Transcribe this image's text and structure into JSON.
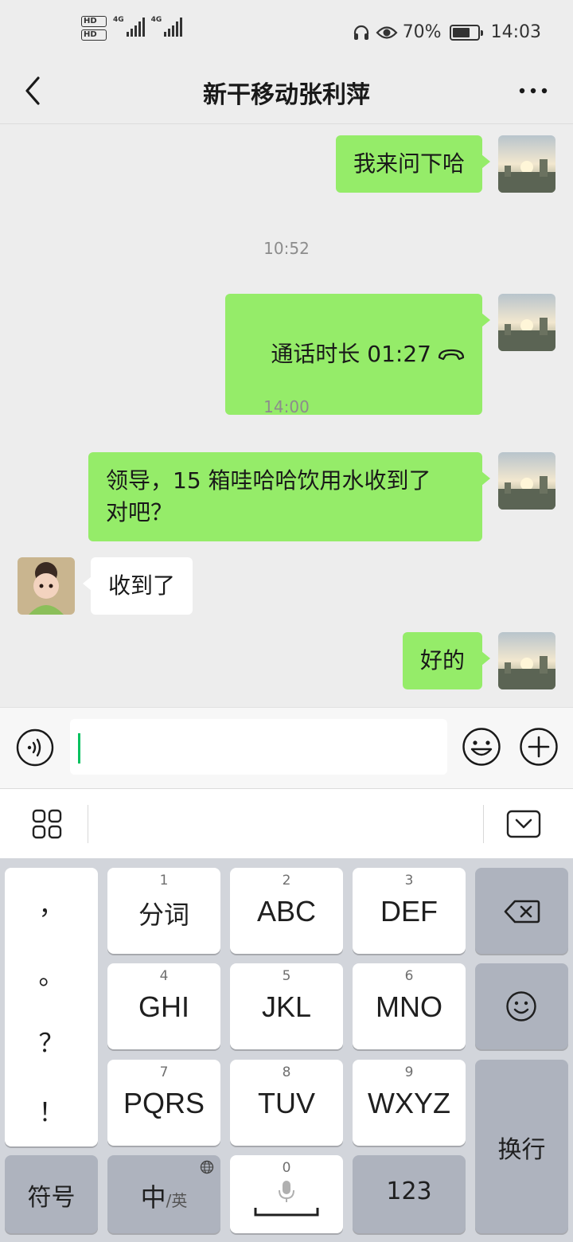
{
  "status_bar": {
    "hd1": "HD",
    "hd2": "HD",
    "sim1_net": "4G",
    "sim2_net": "4G",
    "battery_percent_text": "70%",
    "battery_level": 0.7,
    "time": "14:03",
    "icons": [
      "headphone-icon",
      "eye-icon",
      "battery-icon"
    ]
  },
  "header": {
    "title": "新干移动张利萍",
    "back_icon": "chevron-left-icon",
    "more_icon": "more-dots-icon"
  },
  "messages": [
    {
      "type": "text",
      "sender": "me",
      "text": "我来问下哈"
    },
    {
      "type": "time",
      "text": "10:52"
    },
    {
      "type": "call",
      "sender": "me",
      "text": "通话时长 01:27",
      "icon": "hang-up-phone-icon"
    },
    {
      "type": "time",
      "text": "14:00"
    },
    {
      "type": "text",
      "sender": "me",
      "text": "领导，15 箱哇哈哈饮用水收到了\n对吧？"
    },
    {
      "type": "text",
      "sender": "other",
      "text": "收到了"
    },
    {
      "type": "text",
      "sender": "me",
      "text": "好的"
    }
  ],
  "input_bar": {
    "voice_icon": "voice-icon",
    "text_value": "",
    "emoji_icon": "emoji-icon",
    "plus_icon": "plus-icon"
  },
  "ime_toolbar": {
    "menu_icon": "grid-icon",
    "hide_icon": "keyboard-hide-icon"
  },
  "keyboard": {
    "punctuation": [
      "，",
      "。",
      "？",
      "！"
    ],
    "keys": [
      {
        "num": "1",
        "label": "分词"
      },
      {
        "num": "2",
        "label": "ABC"
      },
      {
        "num": "3",
        "label": "DEF"
      },
      {
        "num": "4",
        "label": "GHI"
      },
      {
        "num": "5",
        "label": "JKL"
      },
      {
        "num": "6",
        "label": "MNO"
      },
      {
        "num": "7",
        "label": "PQRS"
      },
      {
        "num": "8",
        "label": "TUV"
      },
      {
        "num": "9",
        "label": "WXYZ"
      }
    ],
    "backspace_icon": "backspace-icon",
    "emoji_icon": "smiley-icon",
    "enter_label": "换行",
    "symbol_label": "符号",
    "lang_main": "中",
    "lang_sub": "/英",
    "space_num": "0",
    "mic_icon": "microphone-icon",
    "num_label": "123"
  }
}
